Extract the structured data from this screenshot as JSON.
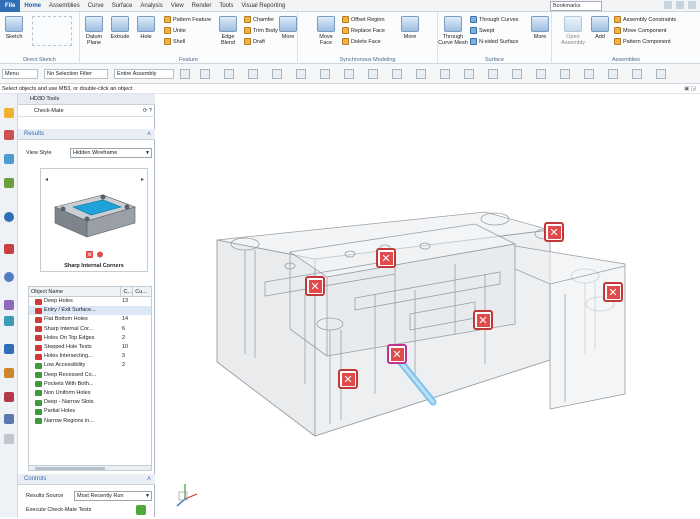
{
  "menubar": {
    "file": "File",
    "tabs": [
      "Home",
      "Assemblies",
      "Curve",
      "Surface",
      "Analysis",
      "View",
      "Render",
      "Tools",
      "Visual Reporting"
    ],
    "active_tab": "Home",
    "search_placeholder": "Bookmarks"
  },
  "ribbon": {
    "direct_sketch": {
      "name": "Direct Sketch",
      "sketch": "Sketch"
    },
    "feature": {
      "name": "Feature",
      "buttons": [
        "Datum Plane",
        "Extrude",
        "Hole"
      ],
      "small": [
        "Pattern Feature",
        "Unite",
        "Shell",
        "Chamfer",
        "Trim Body",
        "Draft",
        "Edge Blend"
      ],
      "more": "More"
    },
    "synchronous": {
      "name": "Synchronous Modeling",
      "buttons": [
        "Move Face"
      ],
      "small": [
        "Offset Region",
        "Replace Face",
        "Delete Face"
      ],
      "more": "More"
    },
    "surface": {
      "name": "Surface",
      "buttons": [
        "Through Curve Mesh"
      ],
      "small": [
        "Through Curves",
        "Swept",
        "N-sided Surface"
      ],
      "more": "More"
    },
    "assemblies": {
      "name": "Assemblies",
      "buttons": [
        "Open Assembly",
        "Add"
      ],
      "small": [
        "Assembly Constraints",
        "Move Component",
        "Pattern Component"
      ]
    }
  },
  "toolbar": {
    "menu": "Menu",
    "filter": "No Selection Filter",
    "scope": "Entire Assembly"
  },
  "cue_line": "Select objects and use MB3, or double-click an object",
  "panel": {
    "title": "HD3D Tools",
    "subtitle": "Check-Mate",
    "results_section": "Results",
    "view_style_label": "View Style",
    "view_style_value": "Hidden Wireframe",
    "preview_caption": "Sharp Internal Corners",
    "columns": [
      "Object Name",
      "C...",
      "Cu..."
    ],
    "rows": [
      {
        "name": "Deep Holes",
        "c": "13",
        "status": "bad"
      },
      {
        "name": "Entry / Exit Surface...",
        "c": "",
        "status": "bad"
      },
      {
        "name": "Flat Bottom Holes",
        "c": "14",
        "status": "bad"
      },
      {
        "name": "Sharp Internal Cor...",
        "c": "6",
        "status": "bad"
      },
      {
        "name": "Holes On Top Edges",
        "c": "2",
        "status": "bad"
      },
      {
        "name": "Stepped Hole Tests",
        "c": "10",
        "status": "bad"
      },
      {
        "name": "Holes Intersecting...",
        "c": "3",
        "status": "bad"
      },
      {
        "name": "Low Accessibility",
        "c": "2",
        "status": "ok"
      },
      {
        "name": "Deep Recessed Co...",
        "c": "",
        "status": "ok"
      },
      {
        "name": "Pockets With Both...",
        "c": "",
        "status": "ok"
      },
      {
        "name": "Non Uniform Holes",
        "c": "",
        "status": "ok"
      },
      {
        "name": "Deep - Narrow Slots",
        "c": "",
        "status": "ok"
      },
      {
        "name": "Partial Holes",
        "c": "",
        "status": "ok"
      },
      {
        "name": "Narrow Regions in...",
        "c": "",
        "status": "ok"
      }
    ],
    "controls_section": "Controls",
    "results_source_label": "Results Source",
    "results_source_value": "Most Recently Run",
    "execute_label": "Execute Check-Mate Tests"
  }
}
